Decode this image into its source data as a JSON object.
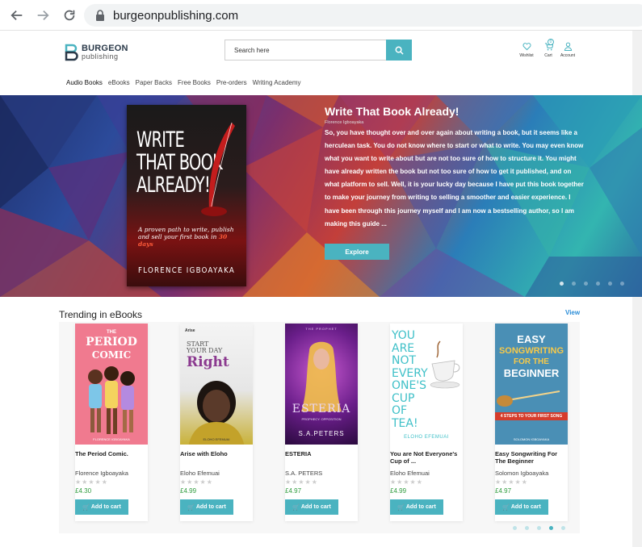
{
  "browser": {
    "url": "burgeonpublishing.com"
  },
  "header": {
    "logo_top": "BURGEON",
    "logo_bottom": "publishing",
    "search_placeholder": "Search here",
    "wishlist_label": "Wishlist",
    "cart_label": "Cart",
    "cart_count": "0",
    "account_label": "Account",
    "accent": "#4ab3c0"
  },
  "categories": [
    "Audio Books",
    "eBooks",
    "Paper Backs",
    "Free Books",
    "Pre-orders",
    "Writing Academy"
  ],
  "hero": {
    "book_cover": {
      "title": "WRITE\nTHAT BOOK\nALREADY!",
      "subtitle": "A proven path to write, publish and sell your first book in",
      "subtitle_em": "30 days",
      "author": "FLORENCE IGBOAYAKA"
    },
    "title": "Write That Book Already!",
    "author": "Florence Igboayaka",
    "description": "So, you have thought over and over again about writing a book, but it seems like a herculean task. You do not know where to start or what to write. You may even know what you want to write about but are not too sure of how to structure it. You might have already written the book but not too sure of how to get it published, and on what platform to sell. Well, it is your lucky day because I have put this book together to make your journey from writing to selling a smoother and easier experience. I have been through this journey myself and I am now a bestselling author, so I am making this guide ...",
    "explore_label": "Explore",
    "slide_count": 6,
    "active_slide": 0
  },
  "trending": {
    "title": "Trending in eBooks",
    "view_label": "View",
    "add_to_cart_label": "Add to cart",
    "books": [
      {
        "title": "The Period Comic.",
        "author": "Florence Igboayaka",
        "price": "£4.30",
        "cover": {
          "line1": "THE",
          "line2": "PERIOD",
          "line3": "COMIC",
          "author": "FLORENCE IGBOAYAKA"
        }
      },
      {
        "title": "Arise with Eloho",
        "author": "Eloho Efemuai",
        "price": "£4.99",
        "cover": {
          "brand": "Arise",
          "line1": "START",
          "line2": "YOUR DAY",
          "line3": "Right",
          "author": "ELOHO EFEMUAI"
        }
      },
      {
        "title": "ESTERIA",
        "author": "S.A. PETERS",
        "price": "£4.97",
        "cover": {
          "top": "THE PROPHET",
          "line1": "ESTERIA",
          "line2": "PROPHECY. OPPOSITION",
          "author": "S.A.PETERS"
        }
      },
      {
        "title": "You are Not Everyone's Cup of ...",
        "author": "Eloho Efemuai",
        "price": "£4.99",
        "cover": {
          "lines": [
            "YOU",
            "ARE",
            "NOT",
            "EVERY",
            "ONE'S",
            "CUP",
            "OF",
            "TEA!"
          ],
          "author": "ELOHO EFEMUAI"
        }
      },
      {
        "title": "Easy Songwriting For The Beginner",
        "author": "Solomon Igboayaka",
        "price": "£4.97",
        "cover": {
          "line1": "EASY",
          "line2": "SONGWRITING",
          "line3": "FOR THE",
          "line4": "BEGINNER",
          "band": "4 STEPS TO YOUR FIRST SONG",
          "author": "SOLOMON IGBOAYAKA"
        }
      }
    ],
    "dot_count": 5,
    "active_dot": 3
  }
}
